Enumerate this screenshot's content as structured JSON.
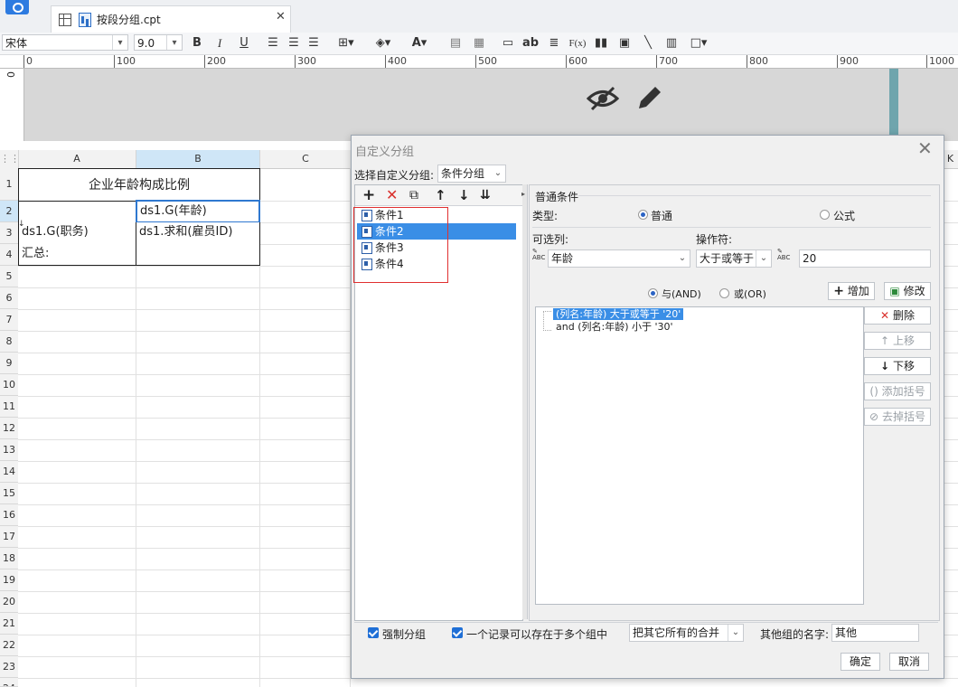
{
  "tab": {
    "title": "按段分组.cpt",
    "close": "✕"
  },
  "toolbar": {
    "font_name": "宋体",
    "font_size": "9.0",
    "bold": "B",
    "italic": "I",
    "underline": "U",
    "text_ab": "ab",
    "formula": "F(x)"
  },
  "ruler": {
    "ticks": [
      "0",
      "100",
      "200",
      "300",
      "400",
      "500",
      "600",
      "700",
      "800",
      "900",
      "1000"
    ],
    "vertical": "0"
  },
  "sheet": {
    "columns": [
      "A",
      "B",
      "C",
      "K"
    ],
    "rows": [
      "1",
      "2",
      "3",
      "4",
      "5",
      "6",
      "7",
      "8",
      "9",
      "10",
      "11",
      "12",
      "13",
      "14",
      "15",
      "16",
      "17",
      "18",
      "19",
      "20",
      "21",
      "22",
      "23",
      "24"
    ],
    "cells": {
      "a1": "企业年龄构成比例",
      "b2": "ds1.G(年龄)",
      "a3": "ds1.G(职务)",
      "b3": "ds1.求和(雇员ID)",
      "a4": "汇总:"
    }
  },
  "dialog": {
    "title": "自定义分组",
    "select_label": "选择自定义分组:",
    "select_value": "条件分组",
    "conditions": [
      "条件1",
      "条件2",
      "条件3",
      "条件4"
    ],
    "section_title": "普通条件",
    "type_label": "类型:",
    "type_normal": "普通",
    "type_formula": "公式",
    "optional_col_label": "可选列:",
    "operator_label": "操作符:",
    "column_value": "年龄",
    "operator_value": "大于或等于",
    "value_input": "20",
    "and_label": "与(AND)",
    "or_label": "或(OR)",
    "add_button": "增加",
    "modify_button": "修改",
    "expressions": [
      "(列名:年龄) 大于或等于 '20'",
      "and (列名:年龄) 小于 '30'"
    ],
    "delete_button": "删除",
    "move_up_button": "上移",
    "move_down_button": "下移",
    "add_bracket_button": "添加括号",
    "remove_bracket_button": "去掉括号",
    "force_group_label": "强制分组",
    "multi_group_label": "一个记录可以存在于多个组中",
    "merge_option": "把其它所有的合并",
    "other_group_label": "其他组的名字:",
    "other_group_value": "其他",
    "ok_button": "确定",
    "cancel_button": "取消"
  },
  "colors": {
    "accent": "#3a8ee6",
    "selection": "#3a8ee6",
    "delete_red": "#d9302c",
    "annotation_red": "#e03030"
  }
}
